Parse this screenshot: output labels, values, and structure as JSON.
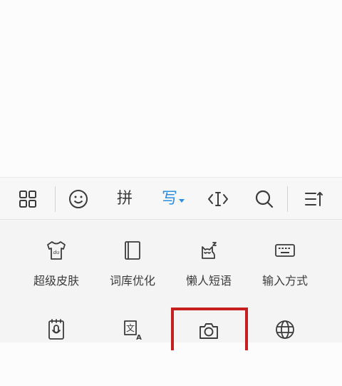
{
  "toolbar": {
    "pinyin_label": "拼",
    "handwrite_label": "写"
  },
  "panel": {
    "items": [
      {
        "label": "超级皮肤",
        "icon": "tshirt-icon"
      },
      {
        "label": "词库优化",
        "icon": "book-icon"
      },
      {
        "label": "懒人短语",
        "icon": "lazy-cat-icon"
      },
      {
        "label": "输入方式",
        "icon": "keyboard-icon"
      },
      {
        "label": "",
        "icon": "microphone-notebook-icon"
      },
      {
        "label": "",
        "icon": "translate-icon"
      },
      {
        "label": "",
        "icon": "camera-icon"
      },
      {
        "label": "",
        "icon": "globe-icon"
      }
    ]
  },
  "colors": {
    "accent": "#2a8de0",
    "icon": "#3b3b3b",
    "highlight": "#c61f1f"
  }
}
